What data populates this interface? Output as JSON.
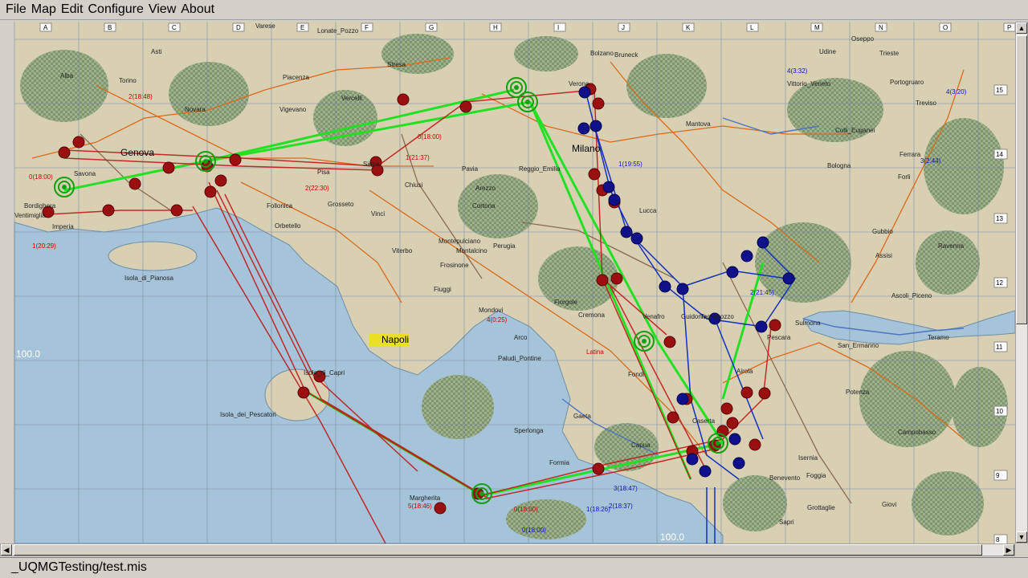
{
  "menu": [
    "File",
    "Map",
    "Configure",
    "View",
    "About"
  ],
  "menu_edit": "Edit",
  "status": "_UQMGTesting/test.mis",
  "grid": {
    "columns": [
      "A",
      "B",
      "C",
      "D",
      "E",
      "F",
      "G",
      "H",
      "I",
      "J",
      "K",
      "L",
      "M",
      "N",
      "O",
      "P"
    ],
    "rows": [
      "15",
      "14",
      "13",
      "12",
      "11",
      "10",
      "9",
      "8"
    ]
  },
  "depth_labels": [
    "100.0",
    "100.0"
  ],
  "cities": [
    "Varese",
    "Lonate_Pozzo",
    "Bolzano",
    "Bruneck",
    "Udine",
    "Oseppo",
    "Trieste",
    "Alba",
    "Asti",
    "Torino",
    "Novara",
    "Piacenza",
    "Vercelli",
    "Stresa",
    "Verona",
    "Vittorio_Veneto",
    "Portogruaro",
    "Treviso",
    "Vigevano",
    "Mantova",
    "Colli_Euganei",
    "Genova",
    "Milano",
    "Ferrara",
    "Pavia",
    "Reggio_Emilia",
    "Bologna",
    "Forli",
    "Savona",
    "Bordighera",
    "Ventimiglia",
    "Imperia",
    "Pisa",
    "Siena",
    "Chiusi",
    "Arezzo",
    "Cortona",
    "Lucca",
    "Follonica",
    "Grosseto",
    "Vinci",
    "Gubbio",
    "Ravenna",
    "Orbetello",
    "Perugia",
    "Montepulciano",
    "Montalcino",
    "Assisi",
    "Isola_di_Pianosa",
    "Viterbo",
    "Frosinone",
    "Fiuggi",
    "Fiorgole",
    "Cremona",
    "Mondovi",
    "Ascoli_Piceno",
    "Teramo",
    "Sulmona",
    "Napoli",
    "Arco",
    "Latina",
    "Paludi_Pontine",
    "Venafro",
    "Guidonia",
    "Tagliacozzo",
    "San_Ermanno",
    "Pescara",
    "Isola_di_Capri",
    "Fondi",
    "Airola",
    "Potenza",
    "Isola_dei_Pescatori",
    "Gaeta",
    "Sperlonga",
    "Capua",
    "Caserta",
    "Campobasso",
    "Formia",
    "Benevento",
    "Isernia",
    "Foggia",
    "Grottaglie",
    "Giovi",
    "Margherita",
    "Sapri"
  ],
  "unit_labels_red": [
    "0(18:00)",
    "2(18:48)",
    "0(18:00)",
    "1(21:37)",
    "2(22:30)",
    "1(20:29)",
    "4(0:25)",
    "0(18:00)",
    "5(18:46)"
  ],
  "unit_labels_blue": [
    "4(3:20)",
    "3(2:44)",
    "1(19:55)",
    "2(21:45)",
    "0(18:00)",
    "1(18:26)",
    "2(18:37)",
    "3(18:47)",
    "4(3:32)"
  ]
}
